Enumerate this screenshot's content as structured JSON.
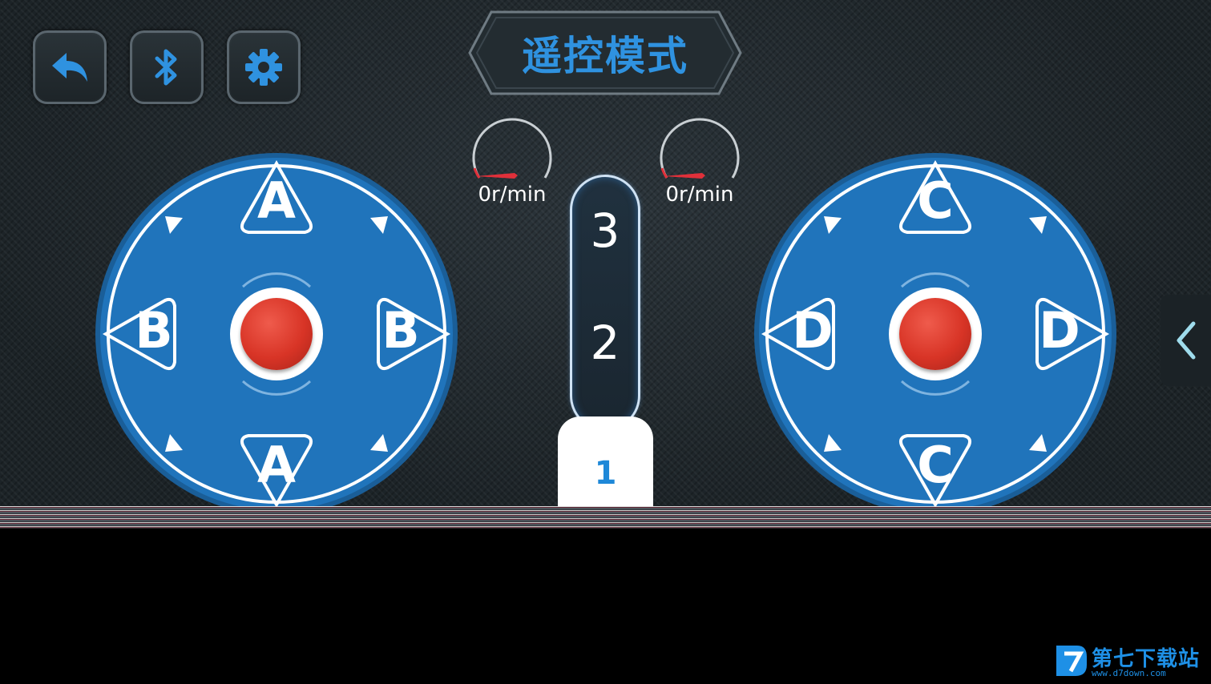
{
  "header": {
    "title": "遥控模式",
    "back_icon": "back-arrow-icon",
    "bluetooth_icon": "bluetooth-icon",
    "settings_icon": "gear-icon"
  },
  "gauges": {
    "left": {
      "label": "0r/min",
      "value": 0
    },
    "right": {
      "label": "0r/min",
      "value": 0
    }
  },
  "left_pad": {
    "top": "A",
    "bottom": "A",
    "left": "B",
    "right": "B"
  },
  "right_pad": {
    "top": "C",
    "bottom": "C",
    "left": "D",
    "right": "D"
  },
  "gear_shifter": {
    "gears": [
      "3",
      "2",
      "1"
    ],
    "selected": "1"
  },
  "side_tab": {
    "icon": "chevron-left-icon"
  },
  "watermark": {
    "brand": "第七下载站",
    "url": "www.d7down.com"
  },
  "colors": {
    "accent": "#2f92e0",
    "pad_blue": "#1f72b8",
    "button_red": "#d83426",
    "needle_red": "#e0303a"
  }
}
